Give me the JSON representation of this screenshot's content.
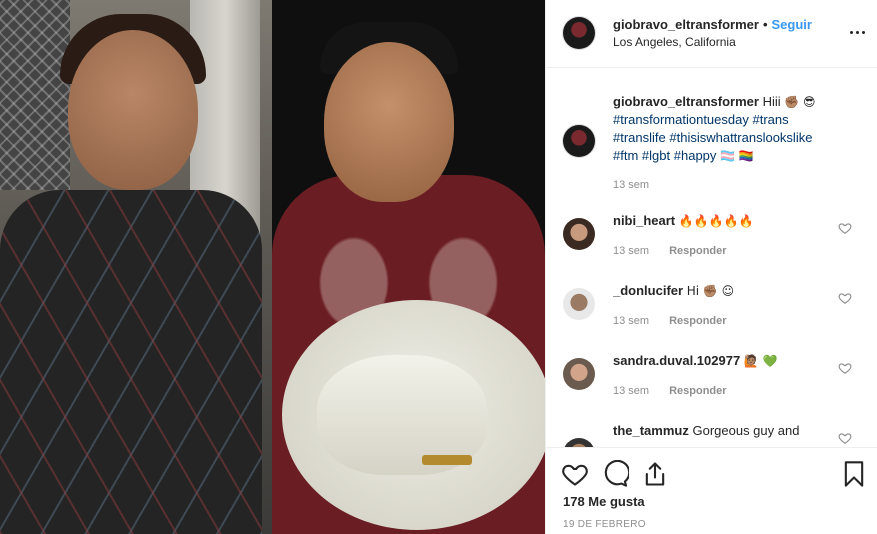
{
  "post": {
    "username": "giobravo_eltransformer",
    "follow_label": "Seguir",
    "location": "Los Angeles, California",
    "caption_lines": [
      [
        "Hiii",
        "✊🏽",
        "😎"
      ],
      [
        "#transformationtuesday",
        "#trans"
      ],
      [
        "#translife",
        "#thisiswhattranslookslike"
      ],
      [
        "#ftm",
        "#lgbt",
        "#happy",
        "🏳️‍⚧️",
        "🏳️‍🌈"
      ]
    ],
    "caption": {
      "text": "Hiii",
      "emoji": "✊🏽 😎",
      "tags1": [
        "#transformationtuesday",
        "#trans"
      ],
      "tags2": [
        "#translife",
        "#thisiswhattranslookslike"
      ],
      "tags3": [
        "#ftm",
        "#lgbt",
        "#happy"
      ],
      "flags": "🏳️‍⚧️ 🏳️‍🌈",
      "time": "13 sem"
    },
    "likes": "178 Me gusta",
    "date": "19 DE FEBRERO"
  },
  "comments": [
    {
      "username": "nibi_heart",
      "text": "🔥🔥🔥🔥🔥",
      "time": "13 sem",
      "reply": "Responder"
    },
    {
      "username": "_donlucifer",
      "text": "Hi ✊🏽 ☺",
      "time": "13 sem",
      "reply": "Responder"
    },
    {
      "username": "sandra.duval.102977",
      "text": "🙋🏽 💚",
      "time": "13 sem",
      "reply": "Responder"
    },
    {
      "username": "the_tammuz",
      "text": "Gorgeous guy and",
      "time": "",
      "reply": ""
    }
  ],
  "icons": {
    "more": "more-options-icon",
    "like": "heart-icon",
    "comment": "comment-icon",
    "share": "share-icon",
    "save": "bookmark-icon"
  }
}
